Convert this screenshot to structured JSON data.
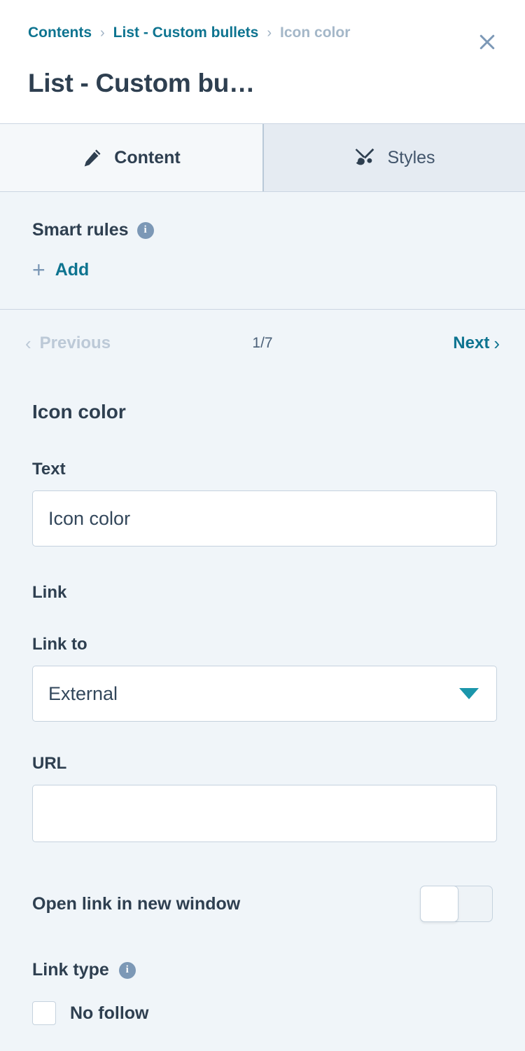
{
  "header": {
    "breadcrumb": [
      {
        "label": "Contents",
        "state": "link"
      },
      {
        "label": "List - Custom bullets",
        "state": "link"
      },
      {
        "label": "Icon color",
        "state": "current"
      }
    ],
    "separator": "›",
    "title": "List - Custom bu…",
    "close_icon": "close-icon"
  },
  "tabs": [
    {
      "label": "Content",
      "icon": "pencil-icon",
      "active": true
    },
    {
      "label": "Styles",
      "icon": "paintbrush-icon",
      "active": false
    }
  ],
  "smart_rules": {
    "title": "Smart rules",
    "info_glyph": "i",
    "add_plus": "+",
    "add_label": "Add"
  },
  "pager": {
    "previous_label": "Previous",
    "previous_chevron": "‹",
    "count": "1/7",
    "next_label": "Next",
    "next_chevron": "›"
  },
  "form": {
    "section_title": "Icon color",
    "text": {
      "label": "Text",
      "value": "Icon color",
      "placeholder": ""
    },
    "link_heading": "Link",
    "link_to": {
      "label": "Link to",
      "value": "External",
      "options": [
        "External"
      ]
    },
    "url": {
      "label": "URL",
      "value": "",
      "placeholder": ""
    },
    "open_new_window": {
      "label": "Open link in new window",
      "state": "off"
    },
    "link_type": {
      "label": "Link type",
      "info_glyph": "i"
    },
    "no_follow": {
      "label": "No follow",
      "checked": false
    }
  },
  "colors": {
    "accent_teal": "#0e7490",
    "dropdown_arrow": "#1b96ab",
    "page_bg": "#f0f5f9",
    "header_bg": "#ffffff",
    "tab_inactive_bg": "#e5ebf2",
    "text_dark": "#2e3f50",
    "muted": "#a4b7c8",
    "border": "#cbd6e2"
  }
}
